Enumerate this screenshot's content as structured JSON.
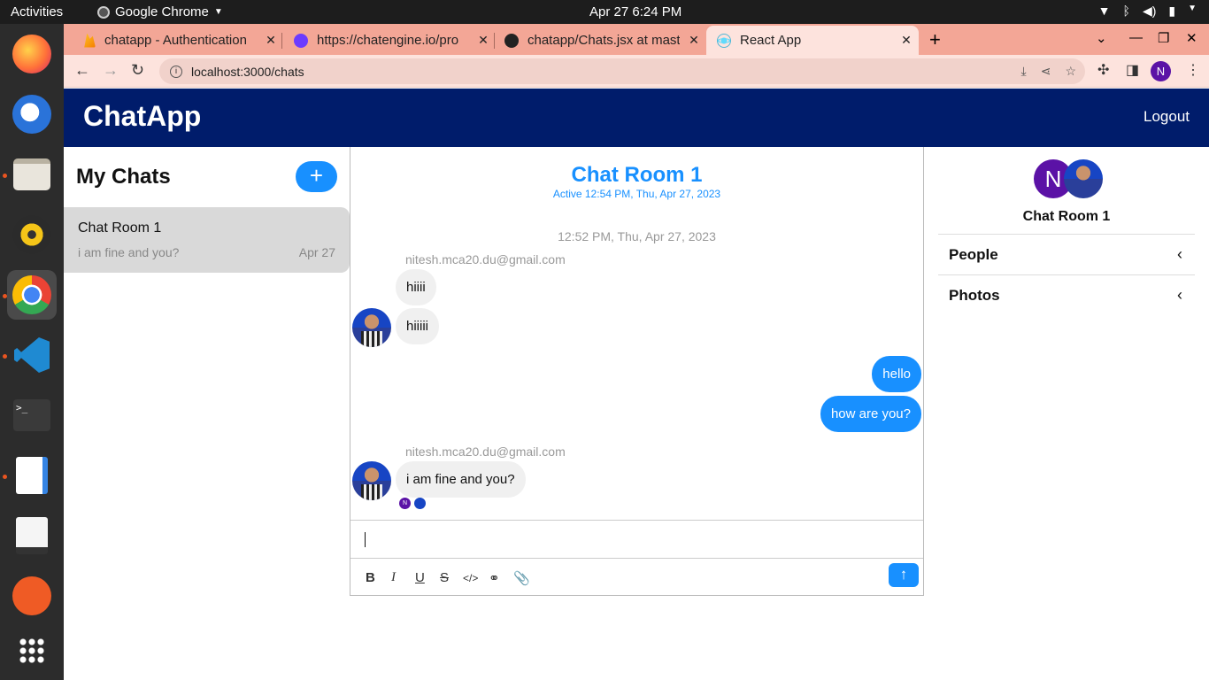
{
  "system": {
    "activities": "Activities",
    "app_name": "Google Chrome",
    "clock": "Apr 27  6:24 PM"
  },
  "browser": {
    "tabs": [
      {
        "title": "chatapp - Authentication"
      },
      {
        "title": "https://chatengine.io/pro"
      },
      {
        "title": "chatapp/Chats.jsx at mast"
      },
      {
        "title": "React App"
      }
    ],
    "url": "localhost:3000/chats",
    "profile_initial": "N"
  },
  "app": {
    "brand": "ChatApp",
    "logout": "Logout"
  },
  "chat_list": {
    "title": "My Chats",
    "new_chat_label": "+",
    "chats": [
      {
        "name": "Chat Room 1",
        "preview": "i am fine and you?",
        "date": "Apr 27"
      }
    ]
  },
  "feed": {
    "title": "Chat Room 1",
    "subtitle": "Active 12:54 PM, Thu, Apr 27, 2023",
    "timestamp": "12:52 PM, Thu, Apr 27, 2023",
    "messages": [
      {
        "sender": "nitesh.mca20.du@gmail.com",
        "text": "hiiii",
        "direction": "in"
      },
      {
        "text": "hiiiii",
        "direction": "in"
      },
      {
        "text": "hello",
        "direction": "out"
      },
      {
        "text": "how are you?",
        "direction": "out"
      },
      {
        "sender": "nitesh.mca20.du@gmail.com",
        "text": "i am fine and you?",
        "direction": "in"
      }
    ],
    "read_by_initial": "N",
    "send_label": "↑"
  },
  "settings": {
    "avatar_initial": "N",
    "room_name": "Chat Room 1",
    "sections": [
      {
        "label": "People"
      },
      {
        "label": "Photos"
      }
    ]
  },
  "colors": {
    "accent": "#1890ff",
    "header": "#001c6b",
    "tabstrip": "#f3a696",
    "profile": "#5b12a6"
  }
}
